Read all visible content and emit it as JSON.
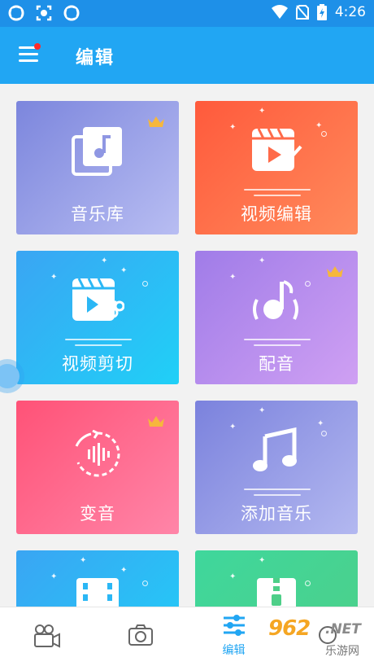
{
  "status_bar": {
    "time": "4:26",
    "icons": [
      "app-notification-icon",
      "screenshot-icon",
      "app-notification-icon",
      "wifi-icon",
      "no-sim-icon",
      "battery-charging-icon"
    ]
  },
  "app_bar": {
    "title": "编辑",
    "menu_icon": "menu-icon",
    "has_notification_dot": true
  },
  "cards": [
    {
      "label": "音乐库",
      "icon": "music-library-icon",
      "premium": true,
      "gradient": [
        "#7c86dd",
        "#b8bdf2"
      ]
    },
    {
      "label": "视频编辑",
      "icon": "video-edit-icon",
      "premium": false,
      "gradient": [
        "#ff5a3c",
        "#ff8a5b"
      ]
    },
    {
      "label": "视频剪切",
      "icon": "video-cut-icon",
      "premium": false,
      "gradient": [
        "#3aa5f3",
        "#20d0f7"
      ]
    },
    {
      "label": "配音",
      "icon": "dubbing-icon",
      "premium": true,
      "gradient": [
        "#a07ce8",
        "#cfa0f3"
      ]
    },
    {
      "label": "变音",
      "icon": "voice-change-icon",
      "premium": true,
      "gradient": [
        "#ff5277",
        "#ff85a8"
      ]
    },
    {
      "label": "添加音乐",
      "icon": "add-music-icon",
      "premium": false,
      "gradient": [
        "#7b82dd",
        "#b3b8f0"
      ]
    },
    {
      "label": "",
      "icon": "film-icon",
      "premium": false,
      "gradient": [
        "#3aa5f3",
        "#20d0f7"
      ]
    },
    {
      "label": "",
      "icon": "zip-icon",
      "premium": false,
      "gradient": [
        "#3fd79c",
        "#4ecf88"
      ]
    }
  ],
  "bottom_nav": {
    "tabs": [
      {
        "icon": "video-camera-icon",
        "label": "",
        "active": false
      },
      {
        "icon": "camera-icon",
        "label": "",
        "active": false
      },
      {
        "icon": "sliders-icon",
        "label": "编辑",
        "active": true
      },
      {
        "icon": "more-icon",
        "label": "",
        "active": false
      }
    ]
  },
  "watermark": {
    "big": "962",
    "net": ".NET",
    "cn": "乐游网"
  },
  "colors": {
    "accent": "#21a6f3",
    "status_bar": "#1e90e8",
    "background": "#f2f2f2"
  }
}
